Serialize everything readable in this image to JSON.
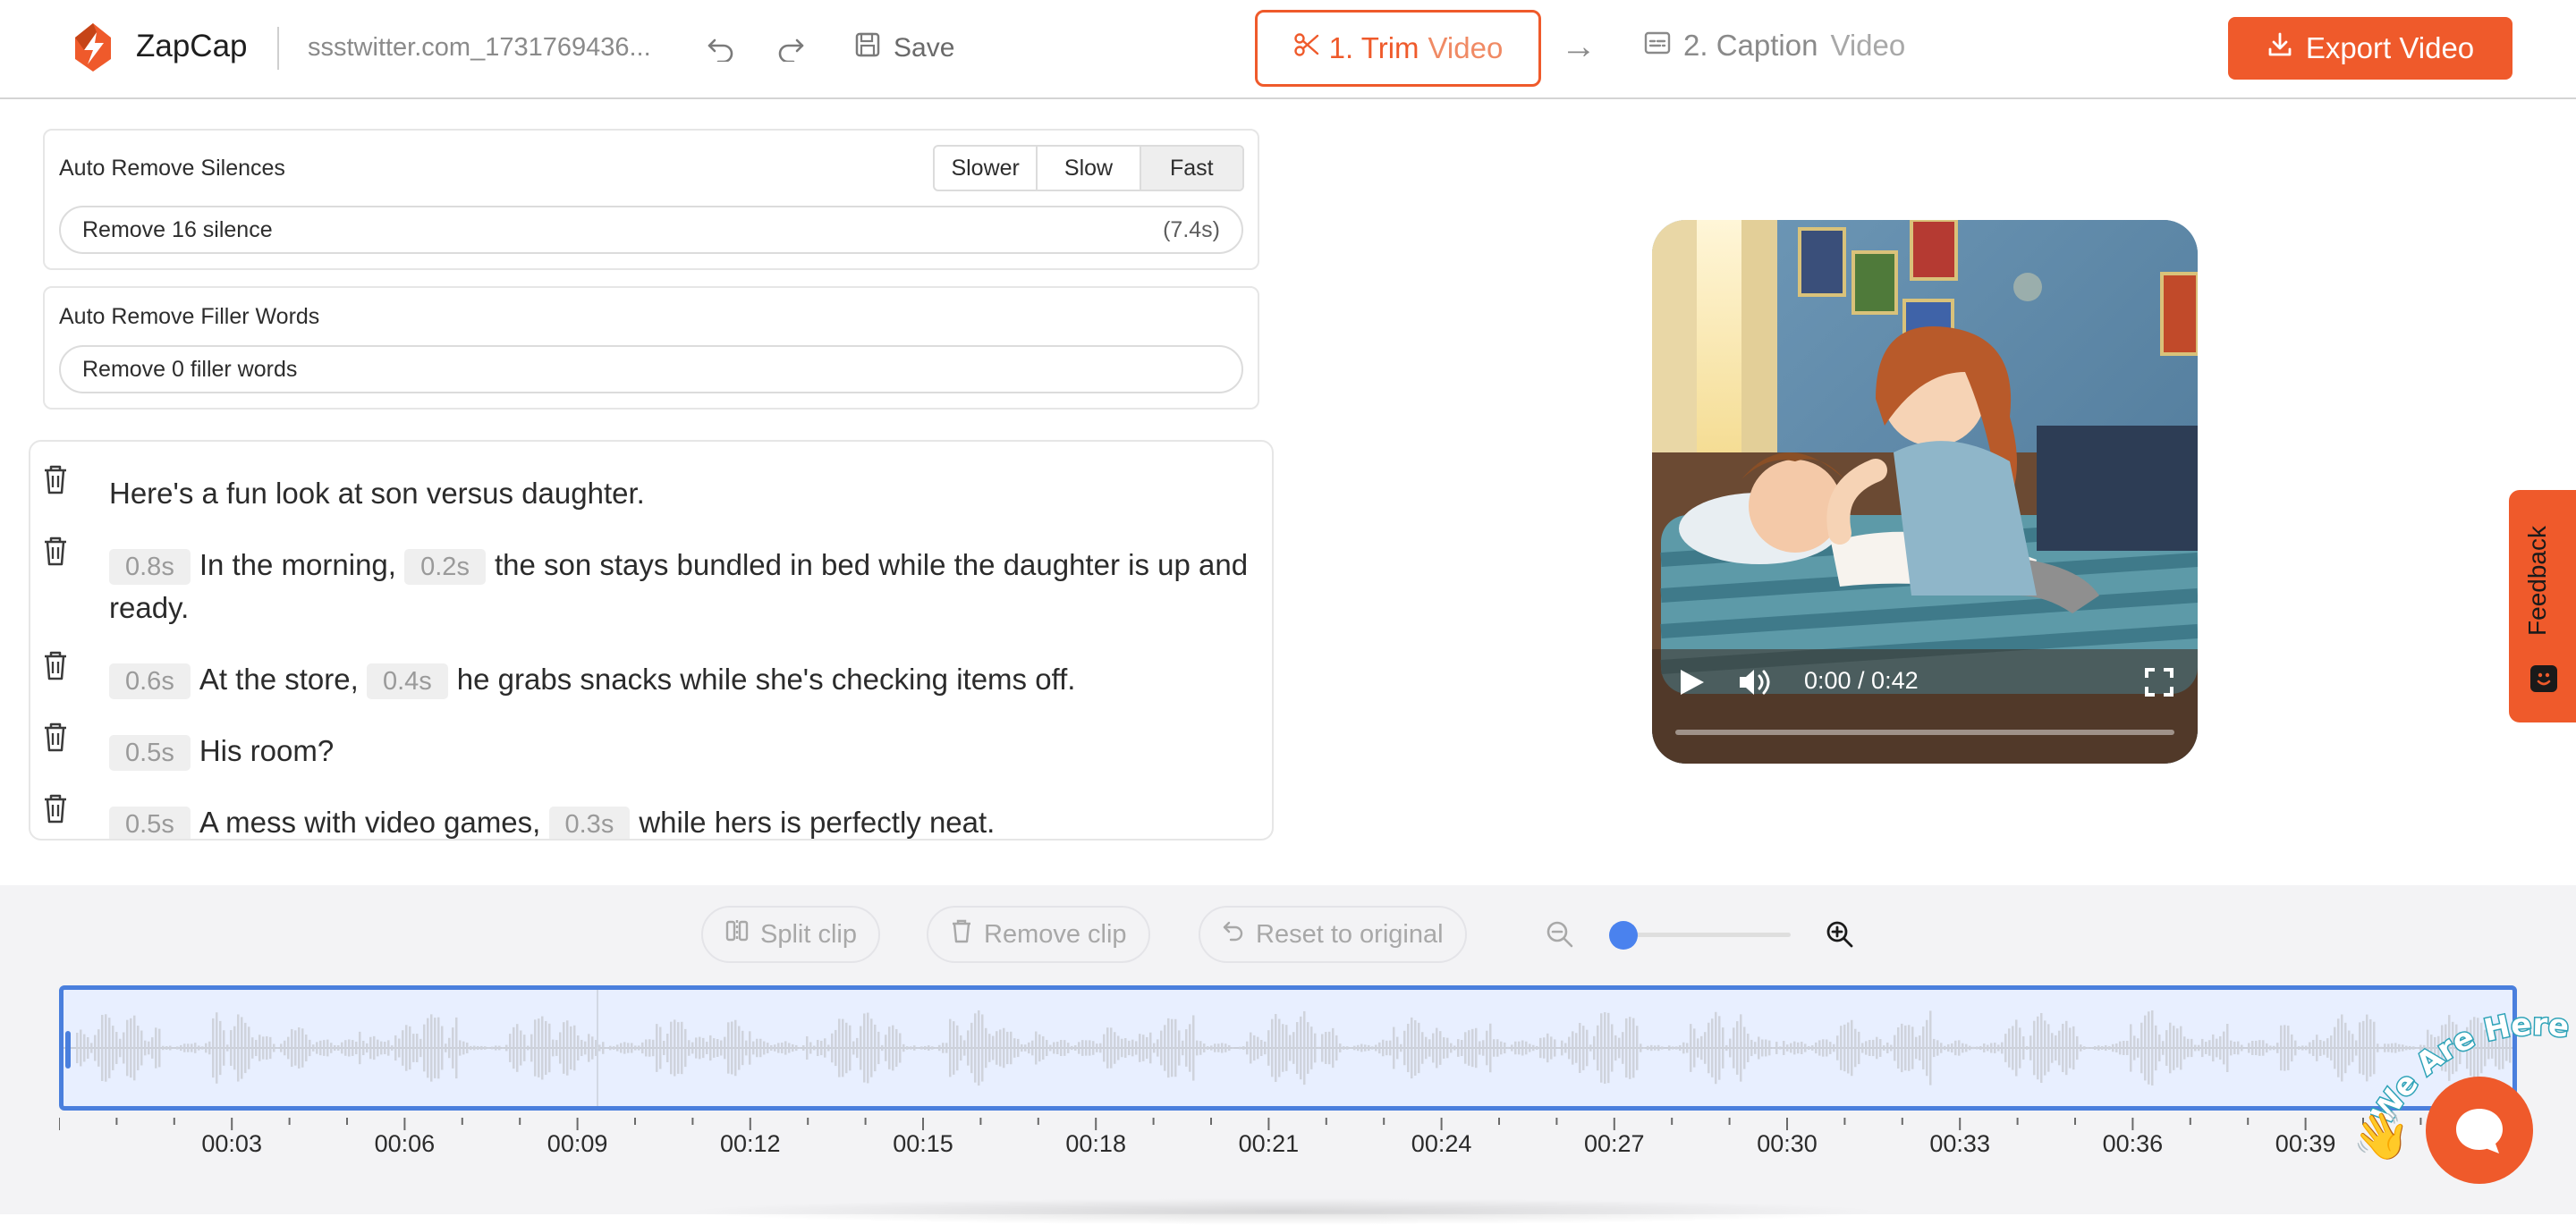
{
  "header": {
    "brand": "ZapCap",
    "filename": "ssstwitter.com_1731769436...",
    "save_label": "Save",
    "step1": {
      "number": "1. Trim",
      "word": "Video"
    },
    "step2": {
      "number": "2. Caption",
      "word": "Video"
    },
    "export_label": "Export Video"
  },
  "silences": {
    "title": "Auto Remove Silences",
    "speeds": [
      "Slower",
      "Slow",
      "Fast"
    ],
    "selected_speed": "Fast",
    "action": "Remove 16 silence",
    "duration": "(7.4s)"
  },
  "fillers": {
    "title": "Auto Remove Filler Words",
    "action": "Remove 0 filler words"
  },
  "transcript": {
    "l1": {
      "text": "Here's a fun look at son versus daughter."
    },
    "l2": {
      "g1": "0.8s",
      "t1": "In the morning,",
      "g2": "0.2s",
      "t2": "the son stays bundled in bed while the daughter is up and ready."
    },
    "l3": {
      "g1": "0.6s",
      "t1": "At the store,",
      "g2": "0.4s",
      "t2": "he grabs snacks while she's checking items off."
    },
    "l4": {
      "g1": "0.5s",
      "t1": "His room?"
    },
    "l5": {
      "g1": "0.5s",
      "t1": "A mess with video games,",
      "g2": "0.3s",
      "t2": "while hers is perfectly neat."
    }
  },
  "player": {
    "time": "0:00 / 0:42",
    "progress": 0
  },
  "feedback_label": "Feedback",
  "edit_toolbar": {
    "split": "Split clip",
    "remove": "Remove clip",
    "reset": "Reset to original",
    "zoom_level": 0
  },
  "timeline": {
    "ticks": [
      "00:03",
      "00:06",
      "00:09",
      "00:12",
      "00:15",
      "00:18",
      "00:21",
      "00:24",
      "00:27",
      "00:30",
      "00:33",
      "00:36",
      "00:39"
    ]
  },
  "chat": {
    "banner": "We Are Here!",
    "wave": "👋"
  },
  "colors": {
    "accent": "#ef5a2b",
    "selection": "#4a7fdd",
    "zoom": "#4a82ee"
  }
}
